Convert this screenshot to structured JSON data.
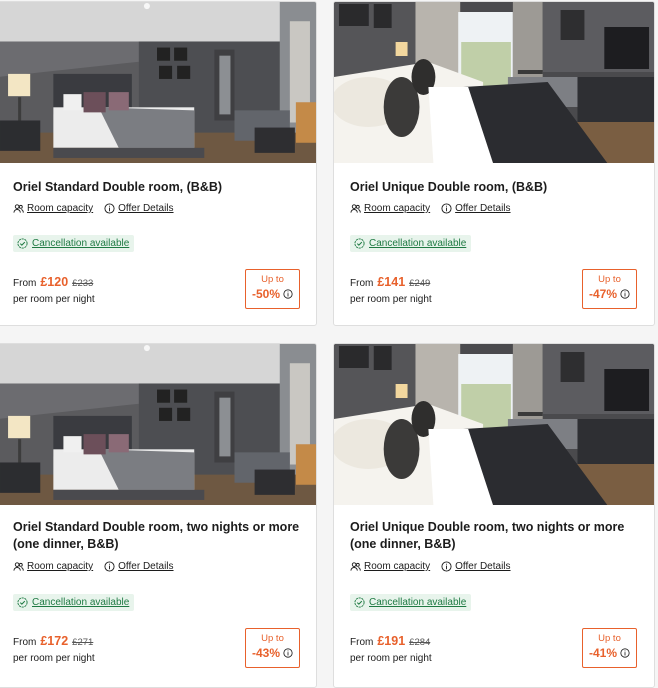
{
  "colors": {
    "accent": "#e8612c",
    "cancel_text": "#1f7a43",
    "cancel_bg": "#e8f4ec"
  },
  "cards": [
    {
      "title": "Oriel Standard Double room, (B&B)",
      "capacity_label": "Room capacity",
      "offer_label": "Offer Details",
      "cancellation": "Cancellation available",
      "from_label": "From",
      "price": "£120",
      "old_price": "£233",
      "per_label": "per room per night",
      "upto_label": "Up to",
      "discount": "-50%",
      "photo": "standard-room-photo"
    },
    {
      "title": "Oriel Unique Double room, (B&B)",
      "capacity_label": "Room capacity",
      "offer_label": "Offer Details",
      "cancellation": "Cancellation available",
      "from_label": "From",
      "price": "£141",
      "old_price": "£249",
      "per_label": "per room per night",
      "upto_label": "Up to",
      "discount": "-47%",
      "photo": "unique-room-photo"
    },
    {
      "title": "Oriel Standard Double room, two nights or more (one dinner, B&B)",
      "capacity_label": "Room capacity",
      "offer_label": "Offer Details",
      "cancellation": "Cancellation available",
      "from_label": "From",
      "price": "£172",
      "old_price": "£271",
      "per_label": "per room per night",
      "upto_label": "Up to",
      "discount": "-43%",
      "photo": "standard-room-photo"
    },
    {
      "title": "Oriel Unique Double room, two nights or more (one dinner, B&B)",
      "capacity_label": "Room capacity",
      "offer_label": "Offer Details",
      "cancellation": "Cancellation available",
      "from_label": "From",
      "price": "£191",
      "old_price": "£284",
      "per_label": "per room per night",
      "upto_label": "Up to",
      "discount": "-41%",
      "photo": "unique-room-photo"
    }
  ]
}
